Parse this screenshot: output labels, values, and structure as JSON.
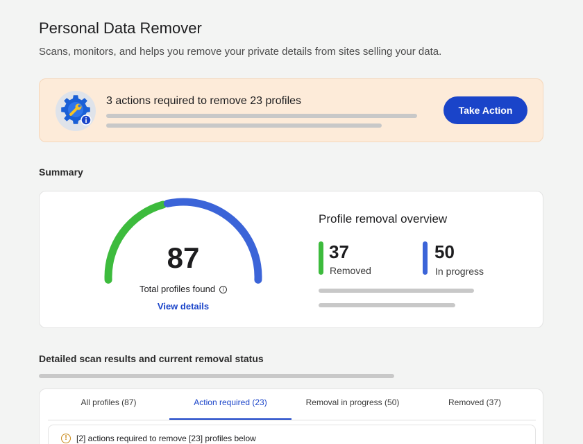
{
  "header": {
    "title": "Personal Data Remover",
    "subtitle": "Scans, monitors, and helps you remove your private details from sites selling your data."
  },
  "alert": {
    "icon": "wrench-gear-icon",
    "title": "3 actions required to remove 23 profiles",
    "button_label": "Take Action",
    "colors": {
      "background": "#fdebd9",
      "button": "#1a44c9"
    }
  },
  "summary": {
    "label": "Summary",
    "total_profiles": "87",
    "total_label": "Total profiles found",
    "view_details": "View details",
    "gauge": {
      "removed_fraction": 0.425,
      "in_progress_fraction": 0.575
    },
    "overview_title": "Profile removal overview",
    "removed": {
      "value": "37",
      "label": "Removed",
      "color": "#3dbb3d"
    },
    "in_progress": {
      "value": "50",
      "label": "In progress",
      "color": "#3b64d8"
    }
  },
  "results": {
    "label": "Detailed scan results and current removal status",
    "tabs": [
      {
        "label": "All profiles (87)",
        "active": false
      },
      {
        "label": "Action required (23)",
        "active": true
      },
      {
        "label": "Removal in progress (50)",
        "active": false
      },
      {
        "label": "Removed (37)",
        "active": false
      }
    ],
    "notice": {
      "icon": "warning-icon",
      "text": "[2] actions required to remove [23] profiles below"
    }
  }
}
